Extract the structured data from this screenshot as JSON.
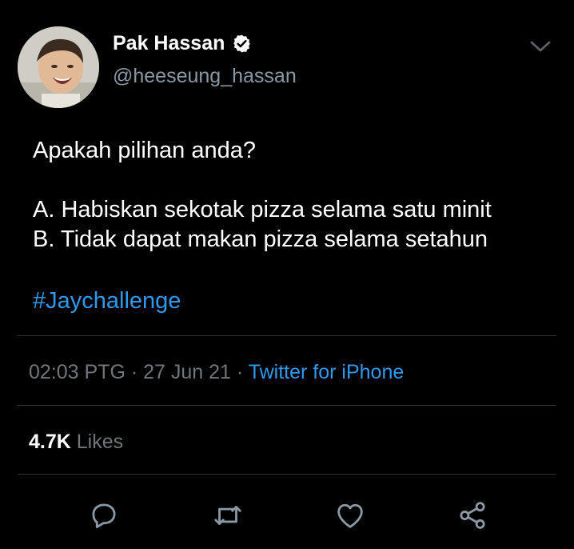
{
  "tweet": {
    "author_name": "Pak Hassan",
    "author_handle": "@heeseung_hassan",
    "line1": "Apakah pilihan anda?",
    "option_a": "A. Habiskan sekotak pizza selama satu minit",
    "option_b": "B. Tidak dapat makan pizza selama setahun",
    "hashtag": "#Jaychallenge",
    "time": "02:03 PTG",
    "date": "27 Jun 21",
    "sep": " · ",
    "source": "Twitter for iPhone",
    "likes_count": "4.7K",
    "likes_label": "Likes"
  },
  "icons": {
    "verified": "verified-badge-icon",
    "caret": "chevron-down-icon",
    "reply": "reply-icon",
    "retweet": "retweet-icon",
    "like": "heart-icon",
    "share": "share-icon"
  },
  "colors": {
    "background": "#000000",
    "link": "#2f9aec",
    "muted": "#71767b",
    "divider": "#2f3336"
  }
}
